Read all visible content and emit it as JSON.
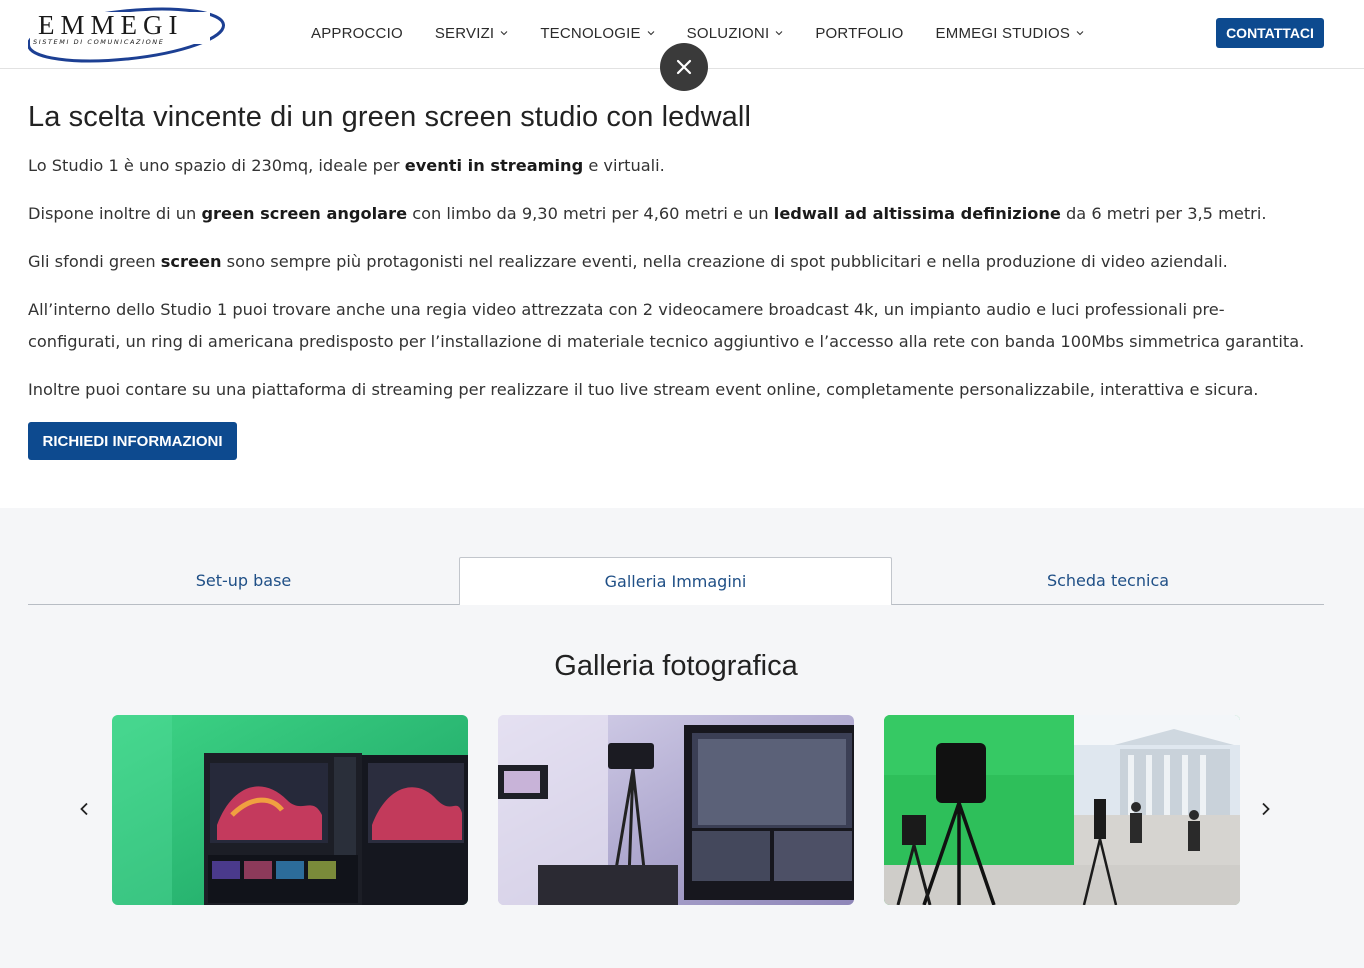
{
  "header": {
    "logo_text": "EMMEGI",
    "logo_tagline": "SISTEMI DI COMUNICAZIONE",
    "nav": [
      {
        "label": "APPROCCIO",
        "has_dropdown": false
      },
      {
        "label": "SERVIZI",
        "has_dropdown": true
      },
      {
        "label": "TECNOLOGIE",
        "has_dropdown": true
      },
      {
        "label": "SOLUZIONI",
        "has_dropdown": true
      },
      {
        "label": "PORTFOLIO",
        "has_dropdown": false
      },
      {
        "label": "EMMEGI STUDIOS",
        "has_dropdown": true
      }
    ],
    "cta_label": "CONTATTACI"
  },
  "main": {
    "title": "La scelta vincente di un green screen studio con ledwall",
    "p1": {
      "a": "Lo Studio 1 è uno spazio di 230mq, ideale per ",
      "b": "eventi in streaming",
      "c": " e virtuali."
    },
    "p2": {
      "a": "Dispone inoltre di un ",
      "b": "green screen angolare",
      "c": " con limbo da 9,30 metri per 4,60 metri e un ",
      "d": "ledwall ad altissima definizione",
      "e": " da 6 metri per 3,5 metri."
    },
    "p3": {
      "a": "Gli sfondi green ",
      "b": "screen",
      "c": " sono sempre più protagonisti nel realizzare eventi, nella creazione di spot pubblicitari e nella produzione di video aziendali."
    },
    "p4_line1": "All’interno dello Studio 1 puoi trovare anche una regia video attrezzata con 2 videocamere broadcast 4k, un impianto audio e luci professionali pre-",
    "p4_line2": "configurati, un ring di americana predisposto per l’installazione di materiale tecnico aggiuntivo e l’accesso alla rete con banda 100Mbs simmetrica garantita.",
    "p5": "Inoltre puoi contare su una piattaforma di streaming per realizzare il tuo live stream event online, completamente personalizzabile, interattiva e sicura.",
    "cta_label": "RICHIEDI INFORMAZIONI"
  },
  "tabs": [
    {
      "label": "Set-up base",
      "active": false
    },
    {
      "label": "Galleria Immagini",
      "active": true
    },
    {
      "label": "Scheda tecnica",
      "active": false
    }
  ],
  "gallery": {
    "title": "Galleria fotografica",
    "photos": [
      "studio-monitor-green-screen",
      "regia-camera-showcase",
      "green-screen-set-camera"
    ]
  },
  "colors": {
    "brand": "#0d4a8f",
    "tab_text": "#1f4f86",
    "section_bg": "#f5f6f8",
    "close_bg": "#3a3a3a"
  }
}
